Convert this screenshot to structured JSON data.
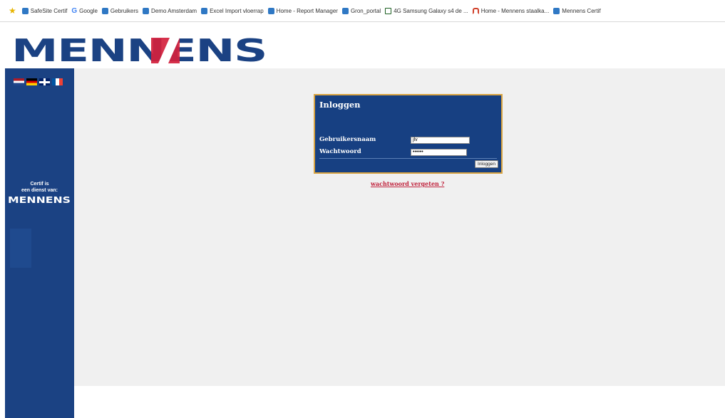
{
  "favorites": {
    "items": [
      {
        "label": "SafeSite Certif",
        "icon": "ie-page-icon"
      },
      {
        "label": "Google",
        "icon": "google-icon"
      },
      {
        "label": "Gebruikers",
        "icon": "ie-page-icon"
      },
      {
        "label": "Demo Amsterdam",
        "icon": "ie-page-icon"
      },
      {
        "label": "Excel Import vloerrap",
        "icon": "ie-page-icon"
      },
      {
        "label": "Home - Report Manager",
        "icon": "ie-page-icon"
      },
      {
        "label": "Gron_portal",
        "icon": "ie-page-icon"
      },
      {
        "label": "4G Samsung Galaxy s4 de ...",
        "icon": "page-box-icon"
      },
      {
        "label": "Home - Mennens staalka...",
        "icon": "mennens-icon"
      },
      {
        "label": "Mennens Certif",
        "icon": "ie-page-icon"
      }
    ]
  },
  "header": {
    "logo_text": "MENNENS"
  },
  "sidebar": {
    "certif_line1": "Certif is",
    "certif_line2": "een dienst van:",
    "logo_text": "MENNENS",
    "flags": [
      "nl-flag-icon",
      "de-flag-icon",
      "uk-flag-icon",
      "fr-flag-icon"
    ]
  },
  "login": {
    "title": "Inloggen",
    "username_label": "Gebruikersnaam",
    "username_value": "jlv",
    "password_label": "Wachtwoord",
    "password_value": "••••••",
    "button_label": "Inloggen"
  },
  "forgot_link": "wachtwoord vergeten ?",
  "colors": {
    "brand_navy": "#1b4283",
    "brand_red": "#d4213d",
    "login_border": "#d9a441",
    "content_bg": "#f0f0f0"
  }
}
